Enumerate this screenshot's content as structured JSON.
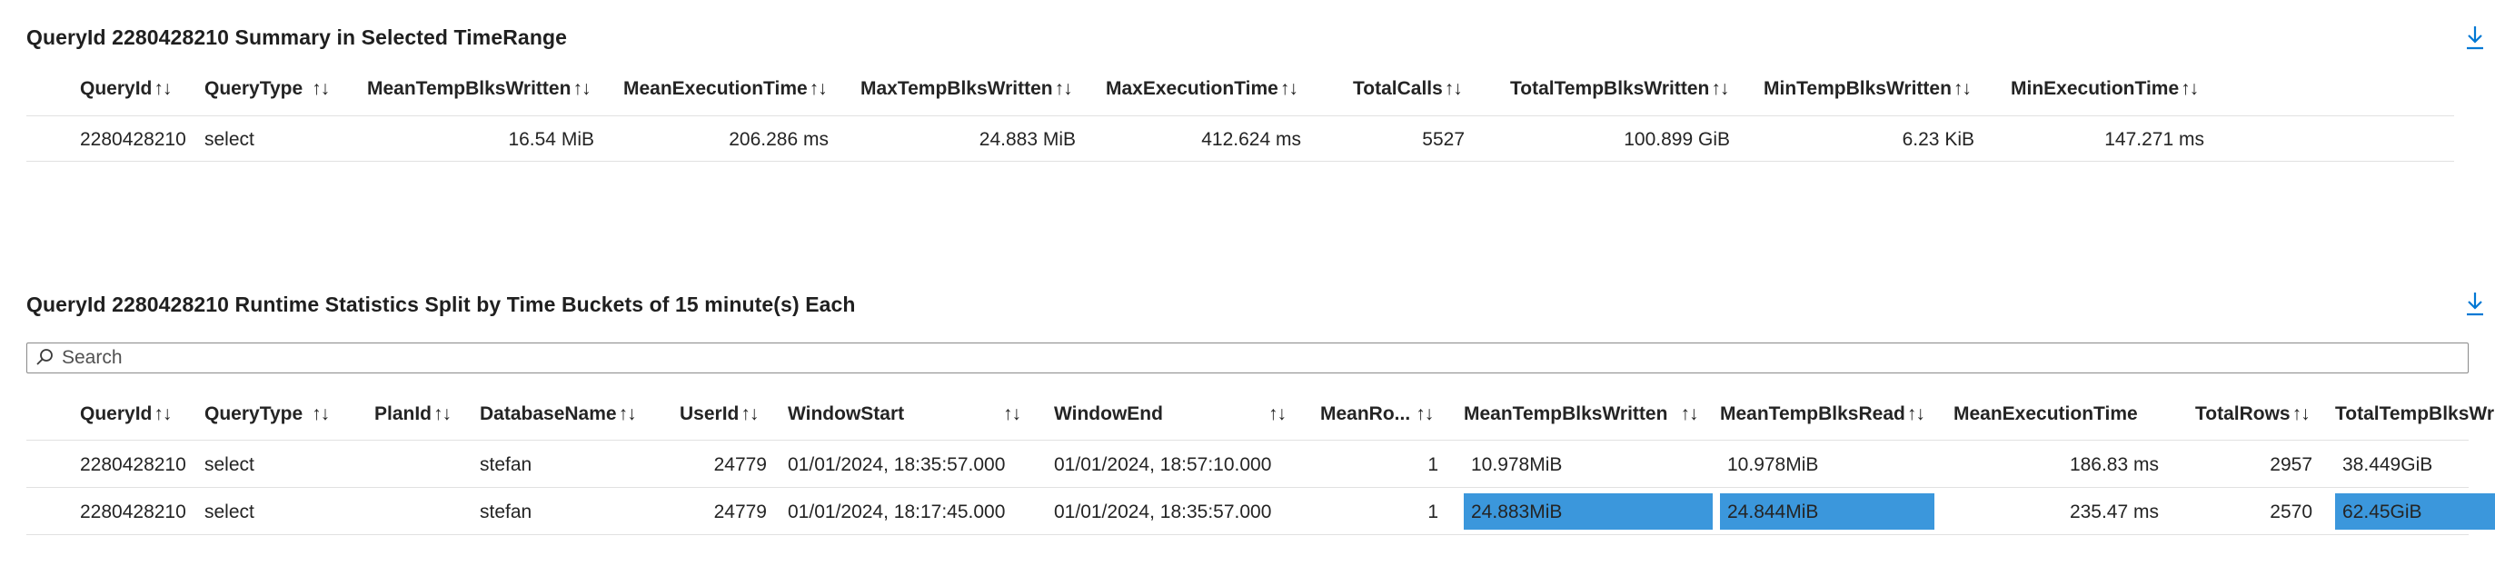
{
  "summary": {
    "title": "QueryId 2280428210 Summary in Selected TimeRange",
    "columns": [
      "QueryId",
      "QueryType",
      "MeanTempBlksWritten",
      "MeanExecutionTime",
      "MaxTempBlksWritten",
      "MaxExecutionTime",
      "TotalCalls",
      "TotalTempBlksWritten",
      "MinTempBlksWritten",
      "MinExecutionTime"
    ],
    "sort_glyph": "↑↓",
    "row": {
      "QueryId": "2280428210",
      "QueryType": "select",
      "MeanTempBlksWritten": "16.54 MiB",
      "MeanExecutionTime": "206.286 ms",
      "MaxTempBlksWritten": "24.883 MiB",
      "MaxExecutionTime": "412.624 ms",
      "TotalCalls": "5527",
      "TotalTempBlksWritten": "100.899 GiB",
      "MinTempBlksWritten": "6.23 KiB",
      "MinExecutionTime": "147.271 ms"
    }
  },
  "runtime": {
    "title": "QueryId 2280428210 Runtime Statistics Split by Time Buckets of 15 minute(s) Each",
    "search_placeholder": "Search",
    "columns": [
      "QueryId",
      "QueryType",
      "PlanId",
      "DatabaseName",
      "UserId",
      "WindowStart",
      "WindowEnd",
      "MeanRo...",
      "MeanTempBlksWritten",
      "MeanTempBlksRead",
      "MeanExecutionTime",
      "TotalRows",
      "TotalTempBlksWr"
    ],
    "sort_glyph": "↑↓",
    "rows": [
      {
        "QueryId": "2280428210",
        "QueryType": "select",
        "PlanId": "",
        "DatabaseName": "stefan",
        "UserId": "24779",
        "WindowStart": "01/01/2024, 18:35:57.000",
        "WindowEnd": "01/01/2024, 18:57:10.000",
        "MeanRows": "1",
        "MeanTempBlksWritten": "10.978MiB",
        "MeanTempBlksRead": "10.978MiB",
        "MeanExecutionTime": "186.83 ms",
        "TotalRows": "2957",
        "TotalTempBlksWritten": "38.449GiB"
      },
      {
        "QueryId": "2280428210",
        "QueryType": "select",
        "PlanId": "",
        "DatabaseName": "stefan",
        "UserId": "24779",
        "WindowStart": "01/01/2024, 18:17:45.000",
        "WindowEnd": "01/01/2024, 18:35:57.000",
        "MeanRows": "1",
        "MeanTempBlksWritten": "24.883MiB",
        "MeanTempBlksRead": "24.844MiB",
        "MeanExecutionTime": "235.47 ms",
        "TotalRows": "2570",
        "TotalTempBlksWritten": "62.45GiB"
      }
    ],
    "bar_fill_fraction": {
      "MeanTempBlksWritten": [
        0,
        1
      ],
      "MeanTempBlksRead": [
        0,
        1
      ],
      "TotalTempBlksWritten": [
        0,
        1
      ]
    }
  },
  "colors": {
    "bar": "#3b97dc",
    "accent": "#0078d4"
  },
  "icons": {
    "download": "download-icon",
    "search": "search-icon"
  }
}
